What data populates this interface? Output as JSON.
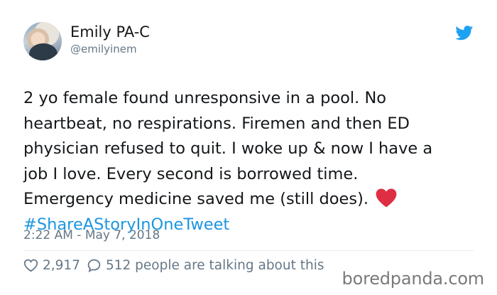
{
  "author": {
    "name": "Emily PA-C",
    "handle": "@emilyinem"
  },
  "tweet": {
    "lines": [
      "2 yo female found unresponsive in a pool. No",
      "heartbeat, no respirations. Firemen and then ED",
      "physician refused to quit. I woke up & now I have a",
      "job I love. Every second is borrowed time.",
      "Emergency medicine saved me (still does)."
    ],
    "emoji": "red-heart-icon",
    "hashtag": "#ShareAStoryInOneTweet",
    "timestamp": "2:22 AM - May 7, 2018"
  },
  "engagement": {
    "likes": "2,917",
    "talking": "512 people are talking about this"
  },
  "watermark": "boredpanda.com",
  "colors": {
    "hashtag": "#1b95e0",
    "twitter_blue": "#1da1f2",
    "heart": "#e0245e",
    "muted": "#657786"
  }
}
